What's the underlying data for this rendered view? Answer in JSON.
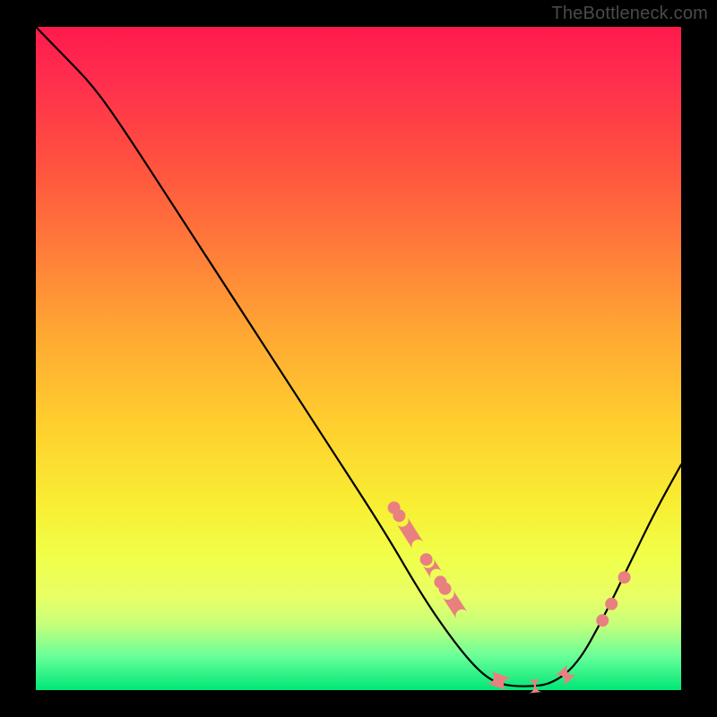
{
  "watermark": "TheBottleneck.com",
  "chart_data": {
    "type": "line",
    "title": "",
    "xlabel": "",
    "ylabel": "",
    "xlim": [
      0,
      100
    ],
    "ylim": [
      0,
      100
    ],
    "curve": [
      {
        "x": 0,
        "y": 100
      },
      {
        "x": 4,
        "y": 96
      },
      {
        "x": 9,
        "y": 91
      },
      {
        "x": 14,
        "y": 84
      },
      {
        "x": 22,
        "y": 72
      },
      {
        "x": 30,
        "y": 60
      },
      {
        "x": 38,
        "y": 48
      },
      {
        "x": 46,
        "y": 36
      },
      {
        "x": 54,
        "y": 24
      },
      {
        "x": 60,
        "y": 14
      },
      {
        "x": 65,
        "y": 7
      },
      {
        "x": 69,
        "y": 2.5
      },
      {
        "x": 72,
        "y": 0.8
      },
      {
        "x": 76,
        "y": 0.5
      },
      {
        "x": 80,
        "y": 0.9
      },
      {
        "x": 84,
        "y": 4
      },
      {
        "x": 88,
        "y": 11
      },
      {
        "x": 92,
        "y": 19
      },
      {
        "x": 96,
        "y": 27
      },
      {
        "x": 100,
        "y": 34
      }
    ],
    "markers": {
      "dots": [
        {
          "x": 55.5,
          "y": 27.5
        },
        {
          "x": 56.3,
          "y": 26.3
        },
        {
          "x": 60.5,
          "y": 19.7
        },
        {
          "x": 62.7,
          "y": 16.3
        },
        {
          "x": 63.4,
          "y": 15.3
        },
        {
          "x": 87.8,
          "y": 10.5
        },
        {
          "x": 89.2,
          "y": 13.0
        },
        {
          "x": 91.2,
          "y": 17.0
        }
      ],
      "pills": [
        {
          "x1": 56.8,
          "y1": 25.5,
          "x2": 59.2,
          "y2": 21.8
        },
        {
          "x1": 60.8,
          "y1": 19.3,
          "x2": 62.1,
          "y2": 17.3
        },
        {
          "x1": 63.8,
          "y1": 14.6,
          "x2": 66.0,
          "y2": 11.3
        },
        {
          "x1": 70.0,
          "y1": 2.0,
          "x2": 73.5,
          "y2": 0.8
        },
        {
          "x1": 76.2,
          "y1": 0.5,
          "x2": 78.5,
          "y2": 0.7
        },
        {
          "x1": 81.0,
          "y1": 1.3,
          "x2": 83.2,
          "y2": 3.2
        }
      ]
    },
    "gradient_stops": [
      {
        "pos": 0,
        "color": "#ff1a4d"
      },
      {
        "pos": 50,
        "color": "#ffcf2e"
      },
      {
        "pos": 100,
        "color": "#00e676"
      }
    ]
  }
}
